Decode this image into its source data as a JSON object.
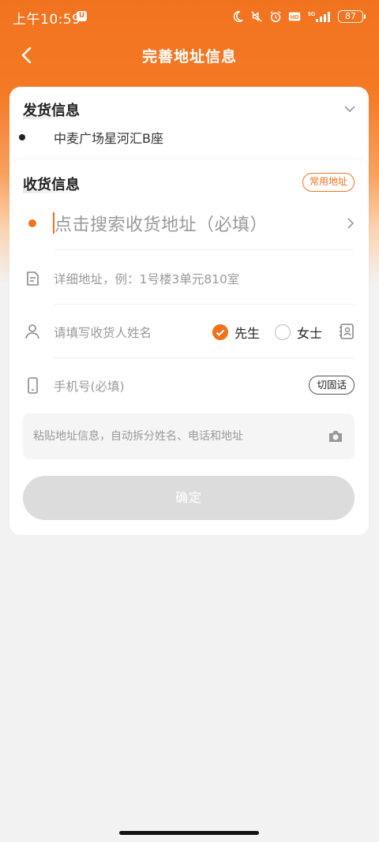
{
  "status_bar": {
    "time": "上午10:59",
    "u_badge": "U",
    "network": "5G",
    "battery": "87"
  },
  "header": {
    "title": "完善地址信息"
  },
  "shipping": {
    "title": "发货信息",
    "address": "中麦广场星河汇B座"
  },
  "receiving": {
    "title": "收货信息",
    "common_address_label": "常用地址",
    "search_placeholder": "点击搜索收货地址（必填）",
    "detail_placeholder": "详细地址，例：1号楼3单元810室",
    "name_placeholder": "请填写收货人姓名",
    "gender_options": [
      {
        "label": "先生",
        "selected": true
      },
      {
        "label": "女士",
        "selected": false
      }
    ],
    "phone_placeholder": "手机号(必填)",
    "switch_landline_label": "切固话",
    "paste_placeholder": "粘贴地址信息，自动拆分姓名、电话和地址",
    "confirm_label": "确定"
  },
  "colors": {
    "accent": "#f0731e",
    "header_bg": "#f2731f",
    "disabled_button": "#dcdcdc"
  }
}
